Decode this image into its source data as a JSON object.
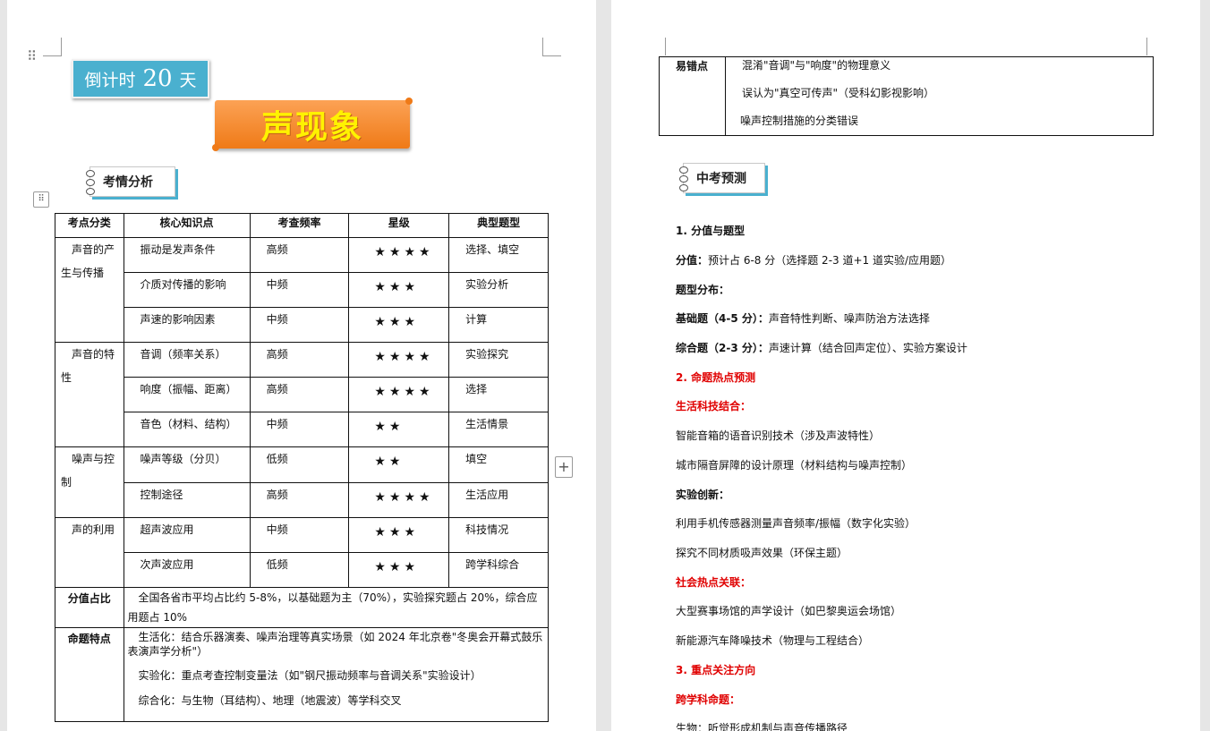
{
  "left_page": {
    "countdown": {
      "prefix": "倒计时",
      "number": "20",
      "suffix": "天"
    },
    "topic_title": "声现象",
    "section_title": "考情分析",
    "table": {
      "headers": [
        "考点分类",
        "核心知识点",
        "考查频率",
        "星级",
        "典型题型"
      ],
      "groups": [
        {
          "category": "声音的产生与传播",
          "rows": [
            {
              "knowledge": "振动是发声条件",
              "frequency": "高频",
              "stars": "★★★★",
              "type": "选择、填空"
            },
            {
              "knowledge": "介质对传播的影响",
              "frequency": "中频",
              "stars": "★★★",
              "type": "实验分析"
            },
            {
              "knowledge": "声速的影响因素",
              "frequency": "中频",
              "stars": "★★★",
              "type": "计算"
            }
          ]
        },
        {
          "category": "声音的特性",
          "rows": [
            {
              "knowledge": "音调（频率关系）",
              "frequency": "高频",
              "stars": "★★★★",
              "type": "实验探究"
            },
            {
              "knowledge": "响度（振幅、距离）",
              "frequency": "高频",
              "stars": "★★★★",
              "type": "选择"
            },
            {
              "knowledge": "音色（材料、结构）",
              "frequency": "中频",
              "stars": "★★",
              "type": "生活情景"
            }
          ]
        },
        {
          "category": "噪声与控制",
          "rows": [
            {
              "knowledge": "噪声等级（分贝）",
              "frequency": "低频",
              "stars": "★★",
              "type": "填空"
            },
            {
              "knowledge": "控制途径",
              "frequency": "高频",
              "stars": "★★★★",
              "type": "生活应用"
            }
          ]
        },
        {
          "category": "声的利用",
          "rows": [
            {
              "knowledge": "超声波应用",
              "frequency": "中频",
              "stars": "★★★",
              "type": "科技情况"
            },
            {
              "knowledge": "次声波应用",
              "frequency": "低频",
              "stars": "★★★",
              "type": "跨学科综合"
            }
          ]
        }
      ],
      "score_row": {
        "label": "分值占比",
        "text": "全国各省市平均占比约 5-8%，以基础题为主（70%），实验探究题占 20%，综合应用题占 10%"
      },
      "feature_row": {
        "label": "命题特点",
        "lines": [
          "生活化：结合乐器演奏、噪声治理等真实场景（如 2024 年北京卷\"冬奥会开幕式鼓乐表演声学分析\"）",
          "实验化：重点考查控制变量法（如\"钢尺振动频率与音调关系\"实验设计）",
          "综合化：与生物（耳结构）、地理（地震波）等学科交叉"
        ]
      }
    }
  },
  "right_page": {
    "errors": {
      "label": "易错点",
      "items": [
        "混淆\"音调\"与\"响度\"的物理意义",
        "误认为\"真空可传声\"（受科幻影视影响）",
        "噪声控制措施的分类错误"
      ]
    },
    "section_title": "中考预测",
    "lines": [
      {
        "style": "bold",
        "text": "1.  分值与题型"
      },
      {
        "style": "mixed",
        "lead": "分值：",
        "text": "预计占 6-8 分（选择题 2-3 道+1 道实验/应用题）"
      },
      {
        "style": "bold",
        "text": "题型分布："
      },
      {
        "style": "mixed",
        "lead": "基础题（4-5 分）：",
        "text": "声音特性判断、噪声防治方法选择"
      },
      {
        "style": "mixed",
        "lead": "综合题（2-3 分）：",
        "text": "声速计算（结合回声定位）、实验方案设计"
      },
      {
        "style": "red",
        "text": "2.  命题热点预测"
      },
      {
        "style": "red",
        "text": "生活科技结合："
      },
      {
        "style": "plain",
        "text": "智能音箱的语音识别技术（涉及声波特性）"
      },
      {
        "style": "plain",
        "text": "城市隔音屏障的设计原理（材料结构与噪声控制）"
      },
      {
        "style": "bold",
        "text": "实验创新："
      },
      {
        "style": "plain",
        "text": "利用手机传感器测量声音频率/振幅（数字化实验）"
      },
      {
        "style": "plain",
        "text": "探究不同材质吸声效果（环保主题）"
      },
      {
        "style": "red",
        "text": "社会热点关联："
      },
      {
        "style": "plain",
        "text": "大型赛事场馆的声学设计（如巴黎奥运会场馆）"
      },
      {
        "style": "plain",
        "text": "新能源汽车降噪技术（物理与工程结合）"
      },
      {
        "style": "red",
        "text": "3.  重点关注方向"
      },
      {
        "style": "red",
        "text": "跨学科命题："
      },
      {
        "style": "plain",
        "text": "生物：听觉形成机制与声音传播路径"
      }
    ]
  },
  "colors": {
    "badge_blue": "#4ab0cf",
    "banner_orange": "#ef7a17",
    "title_yellow": "#fff200",
    "hot_red": "#e00000"
  },
  "icons": {
    "drag": "drag-handle-icon",
    "table_move": "move-icon",
    "add": "plus-icon"
  }
}
